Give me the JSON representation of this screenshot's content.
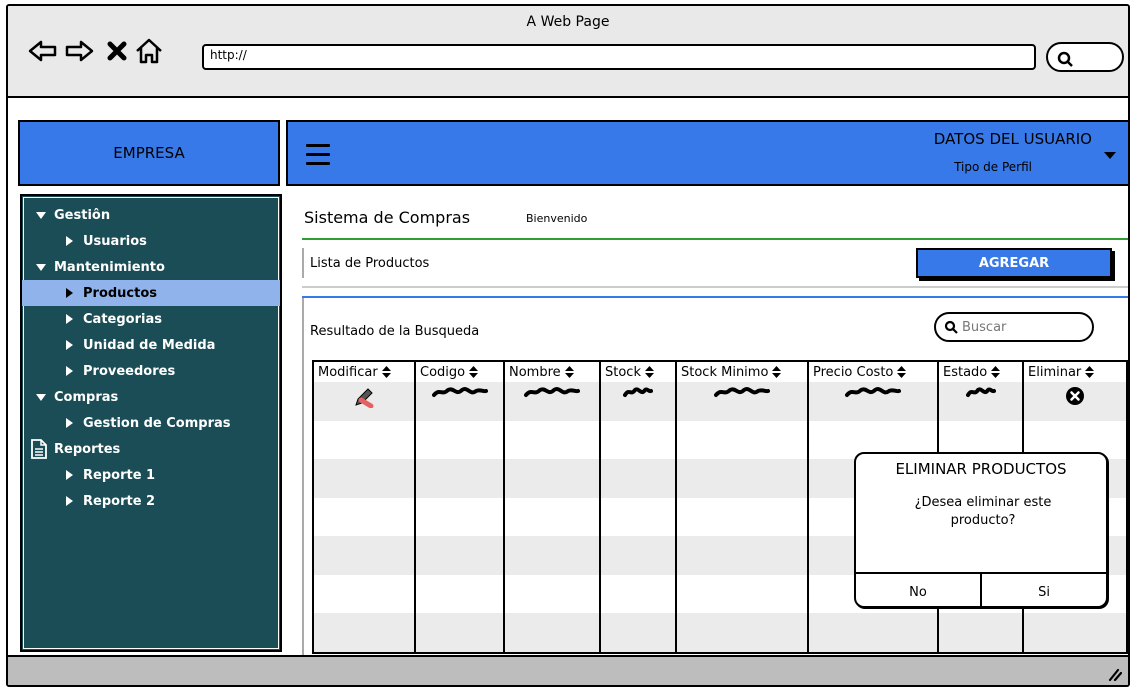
{
  "window": {
    "title": "A Web Page",
    "url": "http://"
  },
  "brand": {
    "name": "EMPRESA"
  },
  "user": {
    "name": "DATOS DEL USUARIO",
    "profile": "Tipo de Perfil"
  },
  "sidebar": {
    "items": [
      {
        "label": "Gestiôn",
        "level": 0,
        "icon": "triangle-down-icon"
      },
      {
        "label": "Usuarios",
        "level": 1,
        "icon": "triangle-right-icon"
      },
      {
        "label": "Mantenimiento",
        "level": 0,
        "icon": "triangle-down-icon"
      },
      {
        "label": "Productos",
        "level": 1,
        "icon": "triangle-right-icon",
        "selected": true
      },
      {
        "label": "Categorias",
        "level": 1,
        "icon": "triangle-right-icon"
      },
      {
        "label": "Unidad de Medida",
        "level": 1,
        "icon": "triangle-right-icon"
      },
      {
        "label": "Proveedores",
        "level": 1,
        "icon": "triangle-right-icon"
      },
      {
        "label": "Compras",
        "level": 0,
        "icon": "triangle-down-icon"
      },
      {
        "label": "Gestion de Compras",
        "level": 1,
        "icon": "triangle-right-icon"
      },
      {
        "label": "Reportes",
        "level": 0,
        "icon": "document-icon"
      },
      {
        "label": "Reporte 1",
        "level": 1,
        "icon": "triangle-right-icon"
      },
      {
        "label": "Reporte 2",
        "level": 1,
        "icon": "triangle-right-icon"
      }
    ]
  },
  "main": {
    "title": "Sistema de Compras",
    "welcome": "Bienvenido",
    "list_label": "Lista de Productos",
    "add_label": "AGREGAR",
    "result_label": "Resultado de la Busqueda",
    "search_placeholder": "Buscar"
  },
  "table": {
    "columns": [
      "Modificar",
      "Codigo",
      "Nombre",
      "Stock",
      "Stock Minimo",
      "Precio Costo",
      "Estado",
      "Eliminar"
    ]
  },
  "dialog": {
    "title": "ELIMINAR PRODUCTOS",
    "message": "¿Desea eliminar este producto?",
    "no_label": "No",
    "yes_label": "Si"
  },
  "colors": {
    "accent": "#3779e8",
    "sidebar": "#1a4d55",
    "selected": "#8fb3ea",
    "rule_green": "#2f9e2f"
  }
}
